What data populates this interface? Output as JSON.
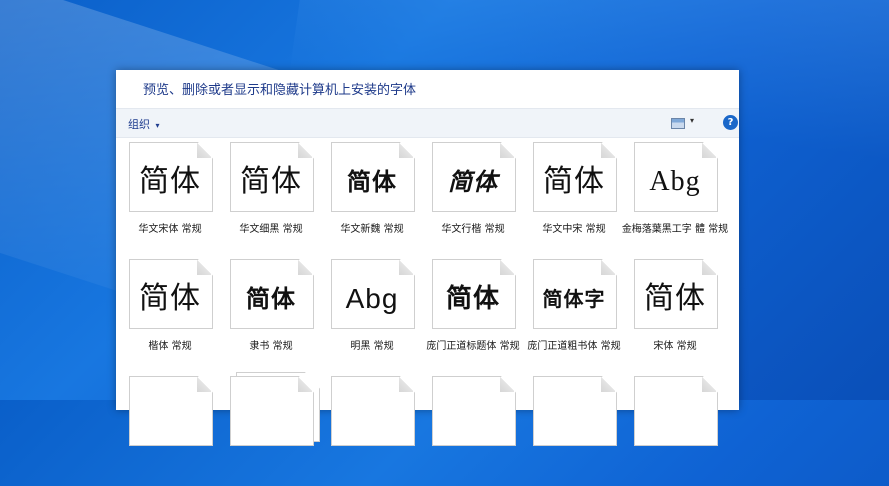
{
  "window": {
    "title": "预览、删除或者显示和隐藏计算机上安装的字体"
  },
  "toolbar": {
    "organize_label": "组织",
    "caret": "▾",
    "help_label": "?"
  },
  "fonts": [
    {
      "sample": "简体",
      "name": "华文宋体 常规"
    },
    {
      "sample": "简体",
      "name": "华文细黑 常规"
    },
    {
      "sample": "简体",
      "name": "华文新魏 常规"
    },
    {
      "sample": "简体",
      "name": "华文行楷 常规"
    },
    {
      "sample": "简体",
      "name": "华文中宋 常规"
    },
    {
      "sample": "Abg",
      "name": "金梅落葉黑工字 體 常规"
    },
    {
      "sample": "简体",
      "name": "楷体 常规"
    },
    {
      "sample": "简体",
      "name": "隶书 常规"
    },
    {
      "sample": "Abg",
      "name": "明黑 常规"
    },
    {
      "sample": "简体",
      "name": "庞门正道标题体 常规"
    },
    {
      "sample": "简体字",
      "name": "庞门正道粗书体 常规"
    },
    {
      "sample": "简体",
      "name": "宋体 常规"
    }
  ],
  "colors": {
    "desktop": "#1470dc",
    "title_text": "#1e3a8a",
    "toolbar_bg": "#f0f4f9",
    "help_button": "#1a67c9"
  },
  "icons": [
    "chevron-down-icon",
    "view-options-icon",
    "help-icon",
    "font-file-icon"
  ]
}
